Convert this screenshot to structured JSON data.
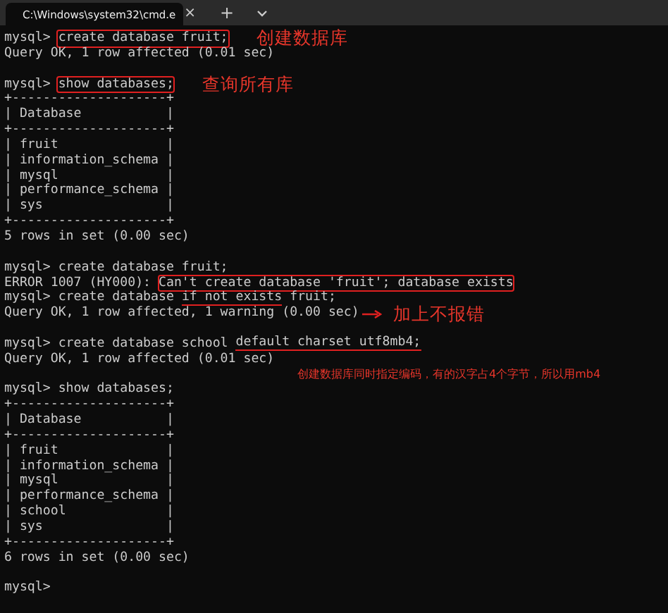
{
  "window": {
    "tab_title": "C:\\Windows\\system32\\cmd.e",
    "close": "×",
    "new_tab": "+"
  },
  "lines": [
    {
      "kind": "text",
      "segments": [
        {
          "text": "mysql> ",
          "kind": "plain"
        },
        {
          "text": "create database fruit;",
          "kind": "box"
        }
      ],
      "note": {
        "text": "创建数据库",
        "kind": "plain"
      }
    },
    {
      "kind": "text",
      "segments": [
        {
          "text": "Query OK, 1 row affected (0.01 sec)",
          "kind": "plain"
        }
      ]
    },
    {
      "kind": "blank"
    },
    {
      "kind": "text",
      "segments": [
        {
          "text": "mysql> ",
          "kind": "plain"
        },
        {
          "text": "show databases;",
          "kind": "box"
        }
      ],
      "note": {
        "text": "查询所有库",
        "kind": "plain"
      }
    },
    {
      "kind": "text",
      "segments": [
        {
          "text": "+--------------------+",
          "kind": "plain"
        }
      ]
    },
    {
      "kind": "text",
      "segments": [
        {
          "text": "| Database           |",
          "kind": "plain"
        }
      ]
    },
    {
      "kind": "text",
      "segments": [
        {
          "text": "+--------------------+",
          "kind": "plain"
        }
      ]
    },
    {
      "kind": "text",
      "segments": [
        {
          "text": "| fruit              |",
          "kind": "plain"
        }
      ]
    },
    {
      "kind": "text",
      "segments": [
        {
          "text": "| information_schema |",
          "kind": "plain"
        }
      ]
    },
    {
      "kind": "text",
      "segments": [
        {
          "text": "| mysql              |",
          "kind": "plain"
        }
      ]
    },
    {
      "kind": "text",
      "segments": [
        {
          "text": "| performance_schema |",
          "kind": "plain"
        }
      ]
    },
    {
      "kind": "text",
      "segments": [
        {
          "text": "| sys                |",
          "kind": "plain"
        }
      ]
    },
    {
      "kind": "text",
      "segments": [
        {
          "text": "+--------------------+",
          "kind": "plain"
        }
      ]
    },
    {
      "kind": "text",
      "segments": [
        {
          "text": "5 rows in set (0.00 sec)",
          "kind": "plain"
        }
      ]
    },
    {
      "kind": "blank"
    },
    {
      "kind": "text",
      "segments": [
        {
          "text": "mysql> create database fruit;",
          "kind": "plain"
        }
      ]
    },
    {
      "kind": "text",
      "segments": [
        {
          "text": "ERROR 1007 (HY000): ",
          "kind": "plain"
        },
        {
          "text": "Can't create database 'fruit'; database exists",
          "kind": "box"
        }
      ]
    },
    {
      "kind": "text",
      "segments": [
        {
          "text": "mysql> create database ",
          "kind": "plain"
        },
        {
          "text": "if not exists",
          "kind": "underline"
        },
        {
          "text": " fruit;",
          "kind": "plain"
        }
      ]
    },
    {
      "kind": "text",
      "segments": [
        {
          "text": "Query OK, 1 row affected, 1 warning (0.00 sec)",
          "kind": "plain"
        }
      ],
      "note": {
        "text": "加上不报错",
        "kind": "arrow"
      }
    },
    {
      "kind": "blank"
    },
    {
      "kind": "text",
      "segments": [
        {
          "text": "mysql> create database school ",
          "kind": "plain"
        },
        {
          "text": "default charset utf8mb4;",
          "kind": "underline"
        }
      ]
    },
    {
      "kind": "text",
      "segments": [
        {
          "text": "Query OK, 1 row affected (0.01 sec)",
          "kind": "plain"
        }
      ]
    },
    {
      "kind": "blank",
      "note": {
        "text": "创建数据库同时指定编码，有的汉字占4个字节，所以用mb4",
        "kind": "plain"
      }
    },
    {
      "kind": "text",
      "segments": [
        {
          "text": "mysql> show databases;",
          "kind": "plain"
        }
      ]
    },
    {
      "kind": "text",
      "segments": [
        {
          "text": "+--------------------+",
          "kind": "plain"
        }
      ]
    },
    {
      "kind": "text",
      "segments": [
        {
          "text": "| Database           |",
          "kind": "plain"
        }
      ]
    },
    {
      "kind": "text",
      "segments": [
        {
          "text": "+--------------------+",
          "kind": "plain"
        }
      ]
    },
    {
      "kind": "text",
      "segments": [
        {
          "text": "| fruit              |",
          "kind": "plain"
        }
      ]
    },
    {
      "kind": "text",
      "segments": [
        {
          "text": "| information_schema |",
          "kind": "plain"
        }
      ]
    },
    {
      "kind": "text",
      "segments": [
        {
          "text": "| mysql              |",
          "kind": "plain"
        }
      ]
    },
    {
      "kind": "text",
      "segments": [
        {
          "text": "| performance_schema |",
          "kind": "plain"
        }
      ]
    },
    {
      "kind": "text",
      "segments": [
        {
          "text": "| school             |",
          "kind": "plain"
        }
      ]
    },
    {
      "kind": "text",
      "segments": [
        {
          "text": "| sys                |",
          "kind": "plain"
        }
      ]
    },
    {
      "kind": "text",
      "segments": [
        {
          "text": "+--------------------+",
          "kind": "plain"
        }
      ]
    },
    {
      "kind": "text",
      "segments": [
        {
          "text": "6 rows in set (0.00 sec)",
          "kind": "plain"
        }
      ]
    },
    {
      "kind": "blank"
    },
    {
      "kind": "text",
      "segments": [
        {
          "text": "mysql>",
          "kind": "plain"
        }
      ]
    }
  ]
}
